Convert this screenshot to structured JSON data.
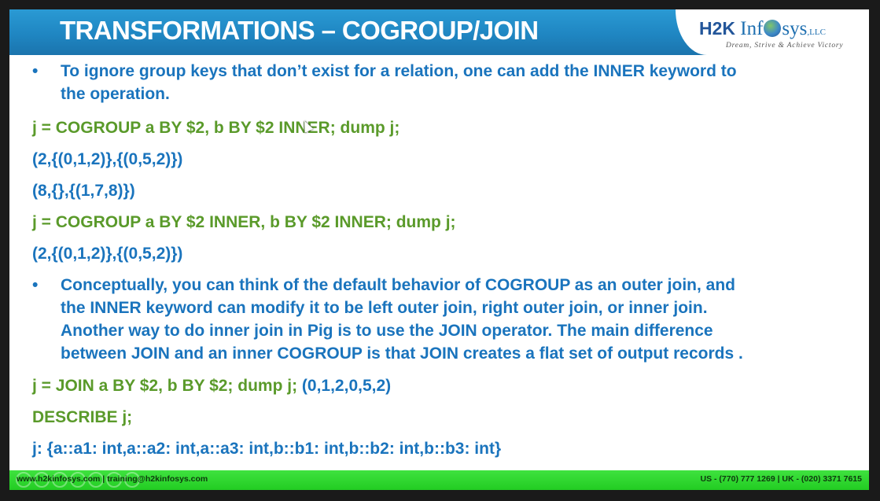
{
  "slide": {
    "title": "TRANSFORMATIONS – COGROUP/JOIN",
    "logo": {
      "brand": "H2K",
      "name_part1": "Inf",
      "name_part2": "sys",
      "suffix": ",LLC",
      "tagline": "Dream, Strive & Achieve Victory"
    }
  },
  "content": {
    "bullet1": "To ignore group keys that don’t exist for a relation, one can add the INNER keyword to\nthe operation.",
    "code1": "j = COGROUP a BY $2, b BY $2 INNER; dump j;",
    "out1": "(2,{(0,1,2)},{(0,5,2)})",
    "out2": "(8,{},{(1,7,8)})",
    "code2": "j = COGROUP a BY $2 INNER, b BY $2 INNER; dump j;",
    "out3": "(2,{(0,1,2)},{(0,5,2)})",
    "bullet2": "Conceptually, you can think of the default behavior of COGROUP as an outer join, and\nthe INNER keyword can modify it to be left outer join, right outer join, or inner join.\nAnother way to do inner join in Pig is to use the JOIN operator. The main difference\nbetween JOIN and an inner COGROUP is that JOIN creates a flat set of output records .",
    "code3": "j = JOIN a BY $2, b BY $2; dump j;",
    "out4": " (0,1,2,0,5,2)",
    "code4": "DESCRIBE j;",
    "out5": "j: {a::a1: int,a::a2: int,a::a3: int,b::b1: int,b::b2: int,b::b3: int}"
  },
  "footer": {
    "left": "www.h2kinfosys.com  |  training@h2kinfosys.com",
    "right": "US - (770) 777 1269  |  UK - (020) 3371 7615"
  }
}
